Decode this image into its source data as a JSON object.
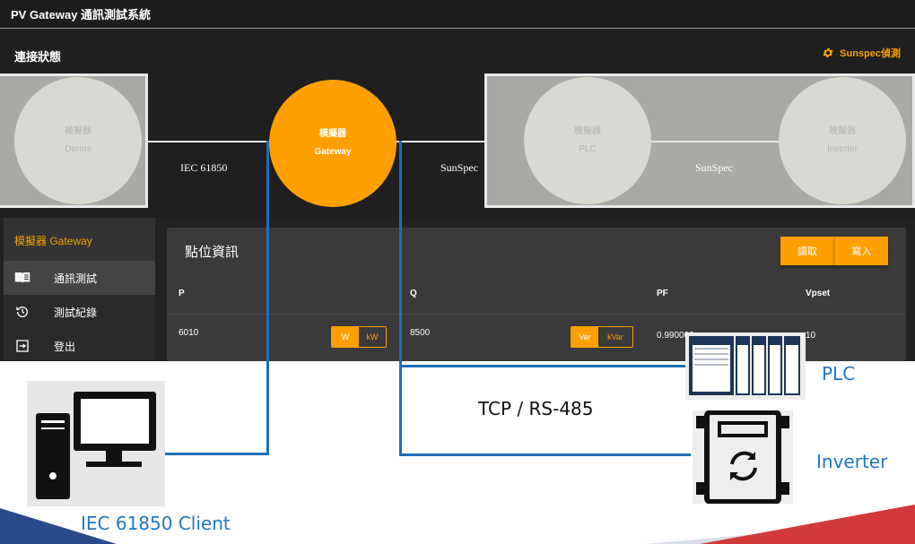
{
  "app": {
    "title": "PV Gateway 通訊測試系統"
  },
  "connection": {
    "label": "連接狀態",
    "sunspec_button": "Sunspec偵測",
    "nodes": {
      "derms": {
        "line1": "模擬器",
        "line2": "Derms"
      },
      "gateway": {
        "line1": "模擬器",
        "line2": "Gateway"
      },
      "plc": {
        "line1": "模擬器",
        "line2": "PLC"
      },
      "inverter": {
        "line1": "模擬器",
        "line2": "Inverter"
      }
    },
    "protocols": {
      "left": "IEC 61850",
      "right": "SunSpec",
      "inner": "SunSpec"
    }
  },
  "sidebar": {
    "header": "模擬器 Gateway",
    "items": [
      {
        "label": "通訊測試",
        "icon": "book-icon"
      },
      {
        "label": "測試紀錄",
        "icon": "history-icon"
      },
      {
        "label": "登出",
        "icon": "logout-icon"
      }
    ]
  },
  "panel": {
    "title": "點位資訊",
    "buttons": {
      "read": "讀取",
      "write": "寫入"
    },
    "columns": [
      "P",
      "Q",
      "PF",
      "Vpset"
    ],
    "row": {
      "p": "6010",
      "p_units": [
        "W",
        "kW"
      ],
      "q": "8500",
      "q_units": [
        "Var",
        "kVar"
      ],
      "pf": "0.990000",
      "vpset": "10"
    }
  },
  "diagram": {
    "client_label": "IEC 61850 Client",
    "link_label": "TCP / RS-485",
    "plc_label": "PLC",
    "inverter_label": "Inverter"
  },
  "colors": {
    "accent": "#ffa000",
    "wire": "#1f6fb5",
    "label_blue": "#2377c2"
  }
}
